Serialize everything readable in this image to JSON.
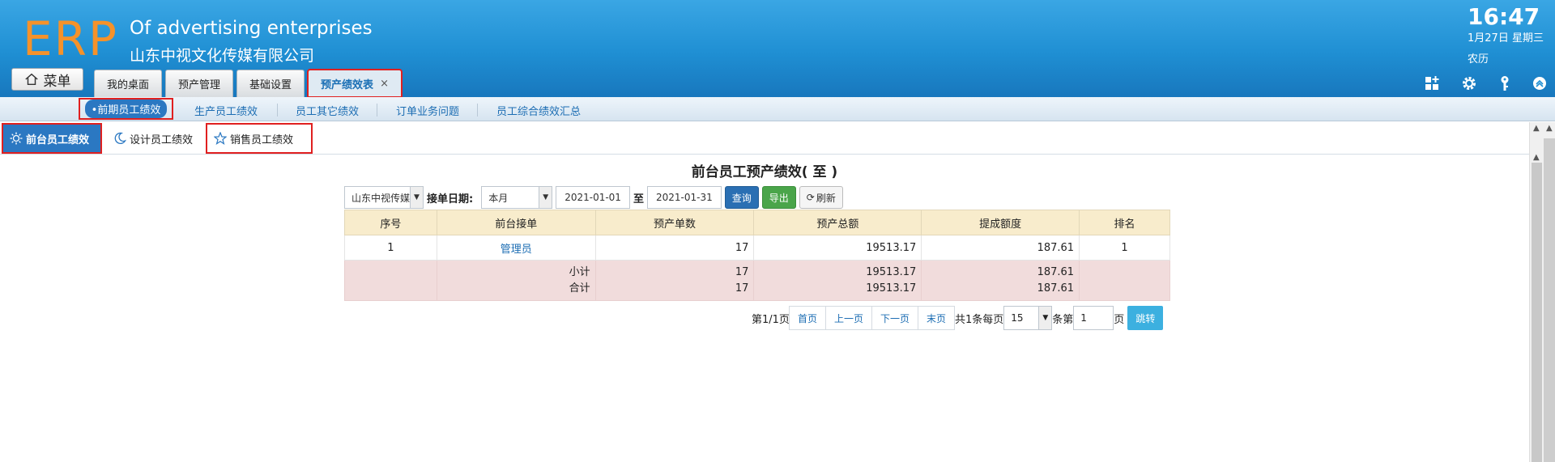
{
  "header": {
    "logo": "ERP",
    "company_en": "Of advertising enterprises",
    "company_cn": "山东中视文化传媒有限公司",
    "time": "16:47",
    "date": "1月27日 星期三",
    "lunar": "农历",
    "menu_label": "菜单",
    "tabs": [
      {
        "label": "我的桌面"
      },
      {
        "label": "预产管理"
      },
      {
        "label": "基础设置"
      },
      {
        "label": "预产绩效表",
        "close": "×"
      }
    ],
    "icons": [
      "grid-plus-icon",
      "gear-icon",
      "key-icon",
      "collapse-up-icon"
    ]
  },
  "subnav": {
    "active": "•前期员工绩效",
    "items": [
      "生产员工绩效",
      "员工其它绩效",
      "订单业务问题",
      "员工综合绩效汇总"
    ]
  },
  "subtabs": {
    "items": [
      {
        "label": "前台员工绩效",
        "icon": "sun-icon"
      },
      {
        "label": "设计员工绩效",
        "icon": "moon-icon"
      },
      {
        "label": "销售员工绩效",
        "icon": "star-icon"
      }
    ]
  },
  "report": {
    "title": "前台员工预产绩效( 至 )",
    "company_select": "山东中视传媒",
    "date_label": "接单日期:",
    "period_select": "本月",
    "date_from": "2021-01-01",
    "to_label": "至",
    "date_to": "2021-01-31",
    "query_btn": "查询",
    "export_btn": "导出",
    "refresh_btn": "刷新",
    "columns": [
      "序号",
      "前台接单",
      "预产单数",
      "预产总额",
      "提成额度",
      "排名"
    ],
    "rows": [
      {
        "no": "1",
        "name": "管理员",
        "count": "17",
        "total": "19513.17",
        "commission": "187.61",
        "rank": "1"
      }
    ],
    "subtotal": {
      "label": "小计",
      "count": "17",
      "total": "19513.17",
      "commission": "187.61"
    },
    "grandtotal": {
      "label": "合计",
      "count": "17",
      "total": "19513.17",
      "commission": "187.61"
    }
  },
  "pager": {
    "page_info": "第1/1页",
    "first": "首页",
    "prev": "上一页",
    "next": "下一页",
    "last": "末页",
    "total_text": "共1条每页",
    "page_size": "15",
    "item_text": "条第",
    "page_input": "1",
    "page_suffix": "页",
    "jump": "跳转"
  },
  "colors": {
    "header_blue": "#1f8fd3",
    "logo_orange": "#f5922a",
    "active_blue": "#2b78c2",
    "highlight_red": "#e02020",
    "table_head": "#f8eccc",
    "total_row": "#f1dcdc"
  }
}
